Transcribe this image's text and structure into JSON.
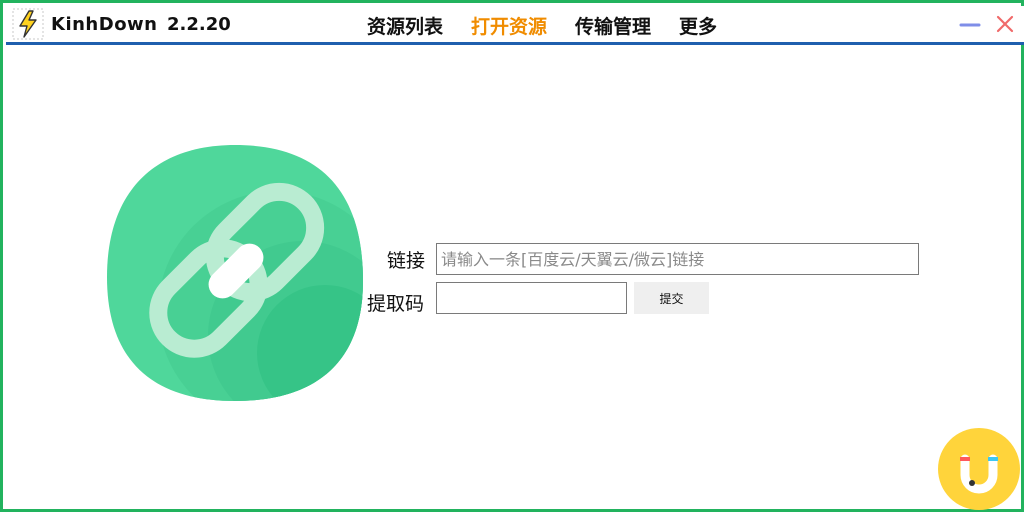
{
  "app": {
    "name": "KinhDown",
    "version": "2.2.20"
  },
  "nav": {
    "items": [
      {
        "label": "资源列表",
        "active": false
      },
      {
        "label": "打开资源",
        "active": true
      },
      {
        "label": "传输管理",
        "active": false
      },
      {
        "label": "更多",
        "active": false
      }
    ]
  },
  "form": {
    "link_label": "链接",
    "link_placeholder": "请输入一条[百度云/天翼云/微云]链接",
    "link_value": "",
    "code_label": "提取码",
    "code_value": "",
    "submit_label": "提交"
  },
  "icons": {
    "app": "lightning-icon",
    "hero": "link-icon",
    "minimize": "minimize-icon",
    "close": "close-icon",
    "mascot": "magnet-mascot-icon"
  },
  "colors": {
    "border": "#22b35e",
    "titlebar_rule": "#1f5fae",
    "nav_active": "#f08c00",
    "hero_green": "#4fd79b",
    "minimize": "#7f8ee8",
    "close": "#f06a6a",
    "mascot_yellow": "#ffd43b"
  }
}
